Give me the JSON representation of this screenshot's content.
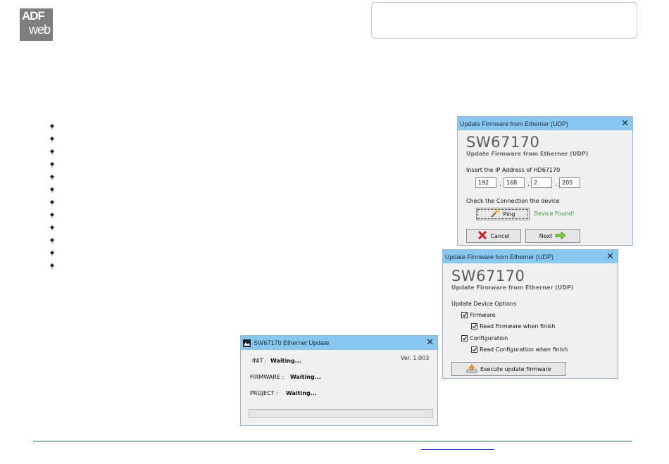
{
  "logo": {
    "line1": "ADF",
    "line2": "web"
  },
  "dialog_ping": {
    "title": "Update Firmware from Etherner (UDP)",
    "close": "✕",
    "product": "SW67170",
    "subtitle": "Update Firmware from Etherner (UDP)",
    "ip_label": "Insert the IP Address of  HD67170",
    "ip": [
      "192",
      "168",
      "2",
      "205"
    ],
    "dot": ".",
    "check_label": "Check the Connection the device",
    "ping_label": "Ping",
    "found_text": "Device Found!",
    "found_color": "#2e9a2e",
    "cancel_label": "Cancel",
    "next_label": "Next"
  },
  "dialog_options": {
    "title": "Update Firmware from Etherner (UDP)",
    "close": "✕",
    "product": "SW67170",
    "subtitle": "Update Firmware from Etherner (UDP)",
    "options_label": "Update Device Options",
    "firmware_label": "Firmware",
    "read_firmware_label": "Read Firmware when finish",
    "configuration_label": "Configuration",
    "read_config_label": "Read Configuration when finish",
    "execute_label": "Execute update firmware"
  },
  "dialog_progress": {
    "title": "SW67170 Ethernet Update",
    "close": "✕",
    "version": "Ver. 1.003",
    "init_label": "INIT :",
    "init_value": "Waiting...",
    "firmware_label": "FIRMWARE :",
    "firmware_value": "Waiting...",
    "project_label": "PROJECT :",
    "project_value": "Waiting...",
    "progress": 0
  },
  "colors": {
    "titlebar": "#88c7f0",
    "footer_line": "#2e6b3e",
    "link": "#2233cc"
  }
}
